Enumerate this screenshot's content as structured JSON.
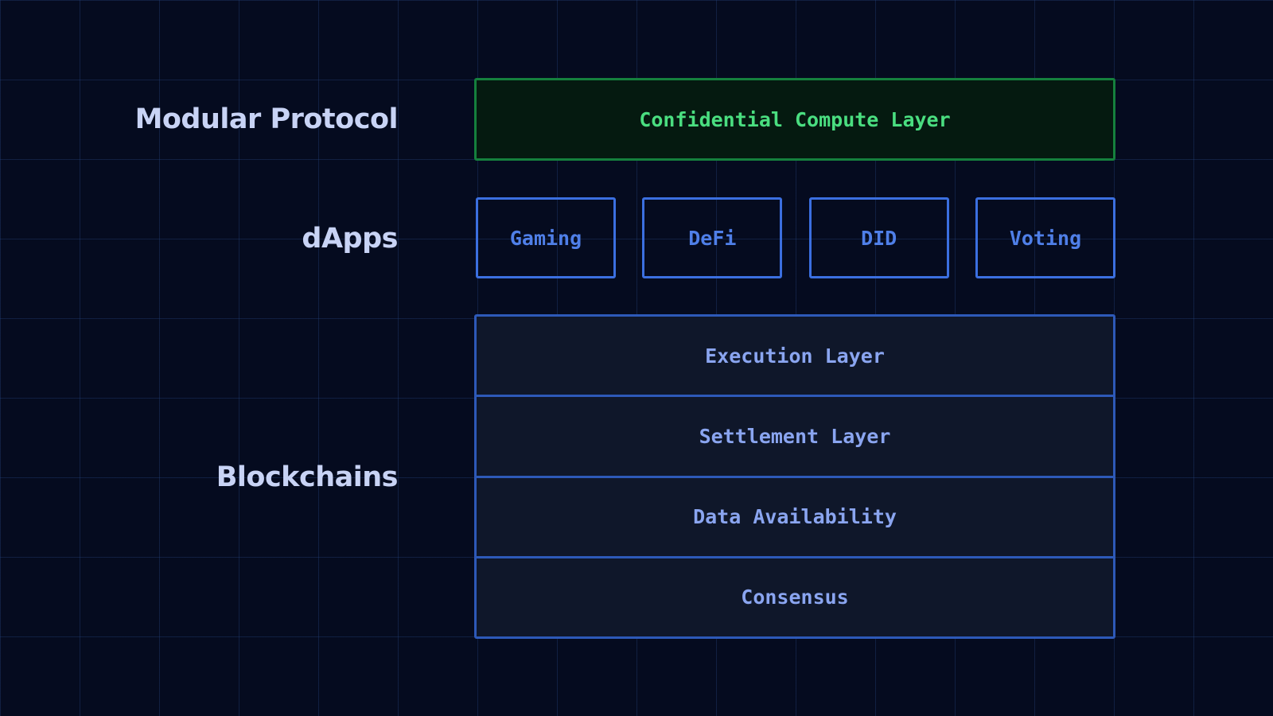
{
  "labels": {
    "modular_protocol": "Modular Protocol",
    "dapps": "dApps",
    "blockchains": "Blockchains"
  },
  "confidential_layer": {
    "label": "Confidential Compute Layer"
  },
  "dapps": [
    {
      "label": "Gaming"
    },
    {
      "label": "DeFi"
    },
    {
      "label": "DID"
    },
    {
      "label": "Voting"
    }
  ],
  "blockchain_layers": [
    {
      "label": "Execution Layer"
    },
    {
      "label": "Settlement Layer"
    },
    {
      "label": "Data Availability"
    },
    {
      "label": "Consensus"
    }
  ],
  "colors": {
    "background": "#050b1f",
    "row_label": "#c8d3f5",
    "compute_border": "#15803d",
    "compute_text": "#4ade80",
    "dapp_border": "#3b6fe0",
    "dapp_text": "#4f7fe8",
    "stack_border": "#2d59b8",
    "stack_fill": "#0f172a",
    "stack_text": "#8aa5f0"
  }
}
